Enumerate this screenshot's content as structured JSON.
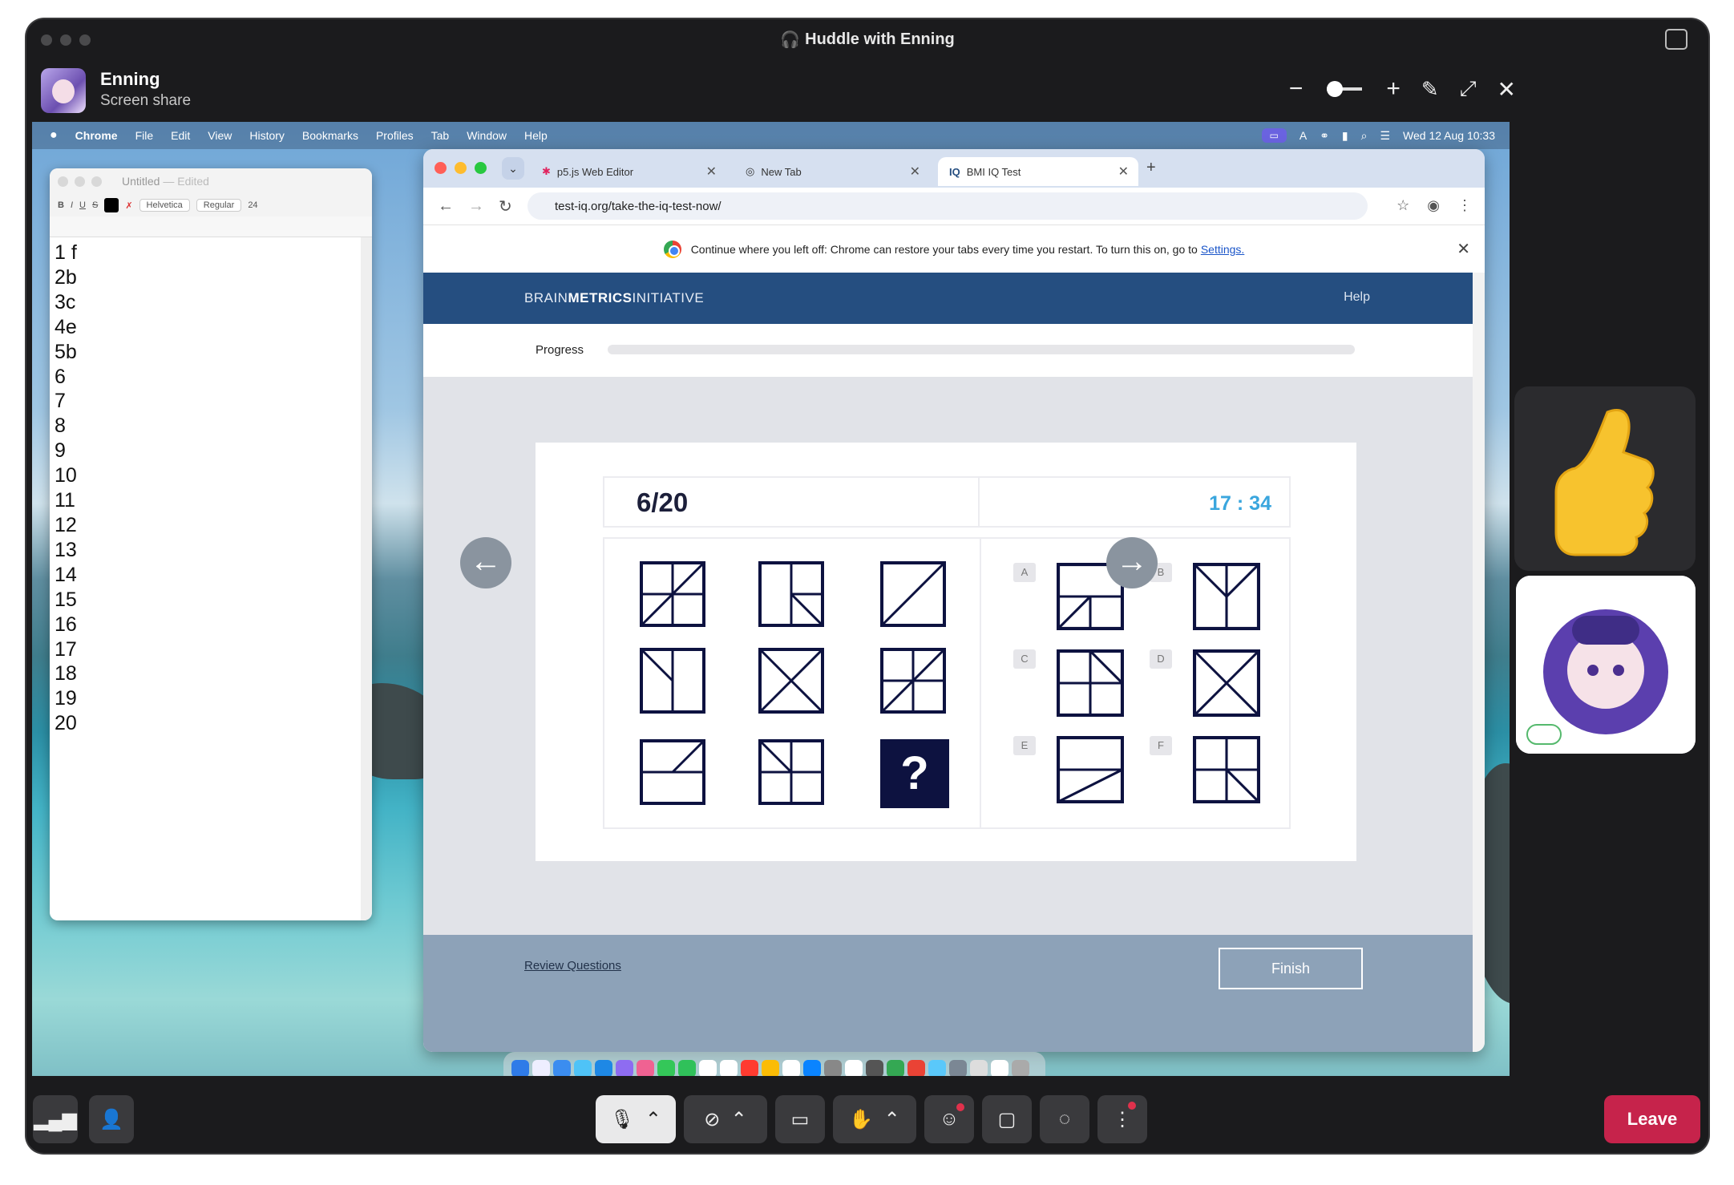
{
  "window": {
    "title": "Huddle with Enning"
  },
  "header": {
    "name": "Enning",
    "subtitle": "Screen share"
  },
  "mac_menu": {
    "items": [
      "Chrome",
      "File",
      "Edit",
      "View",
      "History",
      "Bookmarks",
      "Profiles",
      "Tab",
      "Window",
      "Help"
    ],
    "datetime": "Wed 12 Aug  10:33"
  },
  "textedit": {
    "title": "Untitled",
    "edited": "— Edited",
    "font": "Helvetica",
    "style": "Regular",
    "size": "24",
    "lines": [
      "1 f",
      "2b",
      "3c",
      "4e",
      "5b",
      "6",
      "7",
      "8",
      "9",
      "10",
      "11",
      "12",
      "13",
      "14",
      "15",
      "16",
      "17",
      "18",
      "19",
      "20"
    ]
  },
  "chrome": {
    "tabs": [
      "p5.js Web Editor",
      "New Tab",
      "BMI IQ Test"
    ],
    "url": "test-iq.org/take-the-iq-test-now/",
    "infobar_text": "Continue where you left off: Chrome can restore your tabs every time you restart. To turn this on, go to",
    "infobar_link": "Settings."
  },
  "site": {
    "logo_pre": "BRAIN",
    "logo_bold": "METRICS",
    "logo_post": "INITIATIVE",
    "help": "Help",
    "progress_label": "Progress",
    "progress": 0.0,
    "question": "6/20",
    "timer": "17 : 34",
    "options": [
      "A",
      "B",
      "C",
      "D",
      "E",
      "F"
    ],
    "review": "Review Questions",
    "finish": "Finish"
  },
  "footer": {
    "leave": "Leave"
  },
  "colors": {
    "accent": "#254e80",
    "leave": "#c6234b",
    "timer": "#3aa6de"
  }
}
